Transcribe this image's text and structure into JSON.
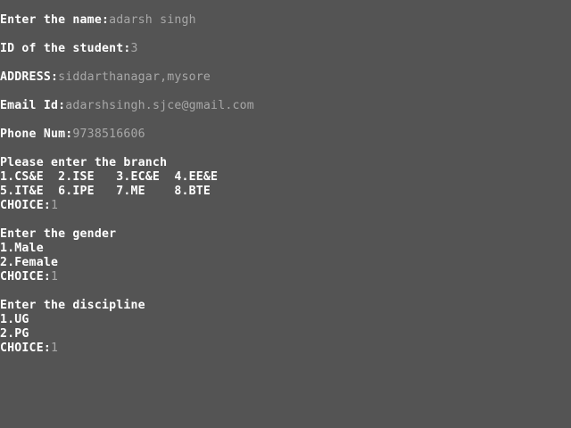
{
  "console": {
    "name_prompt": "Enter the name:",
    "name_value": "adarsh singh",
    "id_prompt": "ID of the student:",
    "id_value": "3",
    "address_prompt": "ADDRESS:",
    "address_value": "siddarthanagar,mysore",
    "email_prompt": "Email Id:",
    "email_value": "adarshsingh.sjce@gmail.com",
    "phone_prompt": "Phone Num:",
    "phone_value": "9738516606",
    "branch_heading": "Please enter the branch",
    "branch_row1": "1.CS&E  2.ISE   3.EC&E  4.EE&E",
    "branch_row2": "5.IT&E  6.IPE   7.ME    8.BTE",
    "branch_choice_label": "CHOICE:",
    "branch_choice_value": "1",
    "gender_heading": "Enter the gender",
    "gender_opt1": "1.Male",
    "gender_opt2": "2.Female",
    "gender_choice_label": "CHOICE:",
    "gender_choice_value": "1",
    "discipline_heading": "Enter the discipline",
    "discipline_opt1": "1.UG",
    "discipline_opt2": "2.PG",
    "discipline_choice_label": "CHOICE:",
    "discipline_choice_value": "1"
  }
}
